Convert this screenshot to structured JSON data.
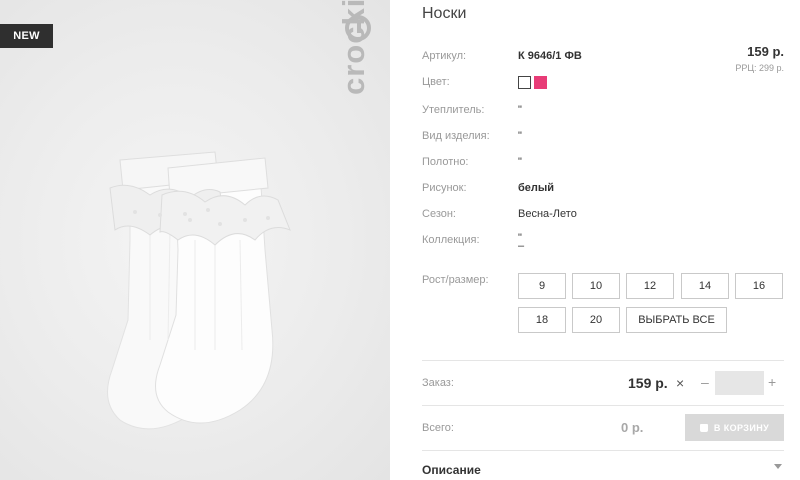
{
  "badge": "NEW",
  "brand": "crockid",
  "product": {
    "title": "Носки",
    "article_label": "Артикул:",
    "article": "К 9646/1 ФВ",
    "price": "159 р.",
    "rrc": "РРЦ: 299 р.",
    "color_label": "Цвет:",
    "colors": [
      "#ffffff",
      "#e83c77"
    ],
    "insulation_label": "Утеплитель:",
    "insulation": "\"",
    "type_label": "Вид изделия:",
    "type": "\"",
    "fabric_label": "Полотно:",
    "fabric": "\"",
    "pattern_label": "Рисунок:",
    "pattern": "белый",
    "season_label": "Сезон:",
    "season": "Весна-Лето",
    "collection_label": "Коллекция:",
    "collection": "\"",
    "collection_extra": "–",
    "size_label": "Рост/размер:",
    "sizes": [
      "9",
      "10",
      "12",
      "14",
      "16",
      "18",
      "20"
    ],
    "select_all": "ВЫБРАТЬ ВСЕ"
  },
  "order": {
    "label": "Заказ:",
    "price": "159 р.",
    "times": "×",
    "minus": "–",
    "plus": "+",
    "quantity": ""
  },
  "total": {
    "label": "Всего:",
    "value": "0 р.",
    "cart_button": "В КОРЗИНУ"
  },
  "description": "Описание"
}
